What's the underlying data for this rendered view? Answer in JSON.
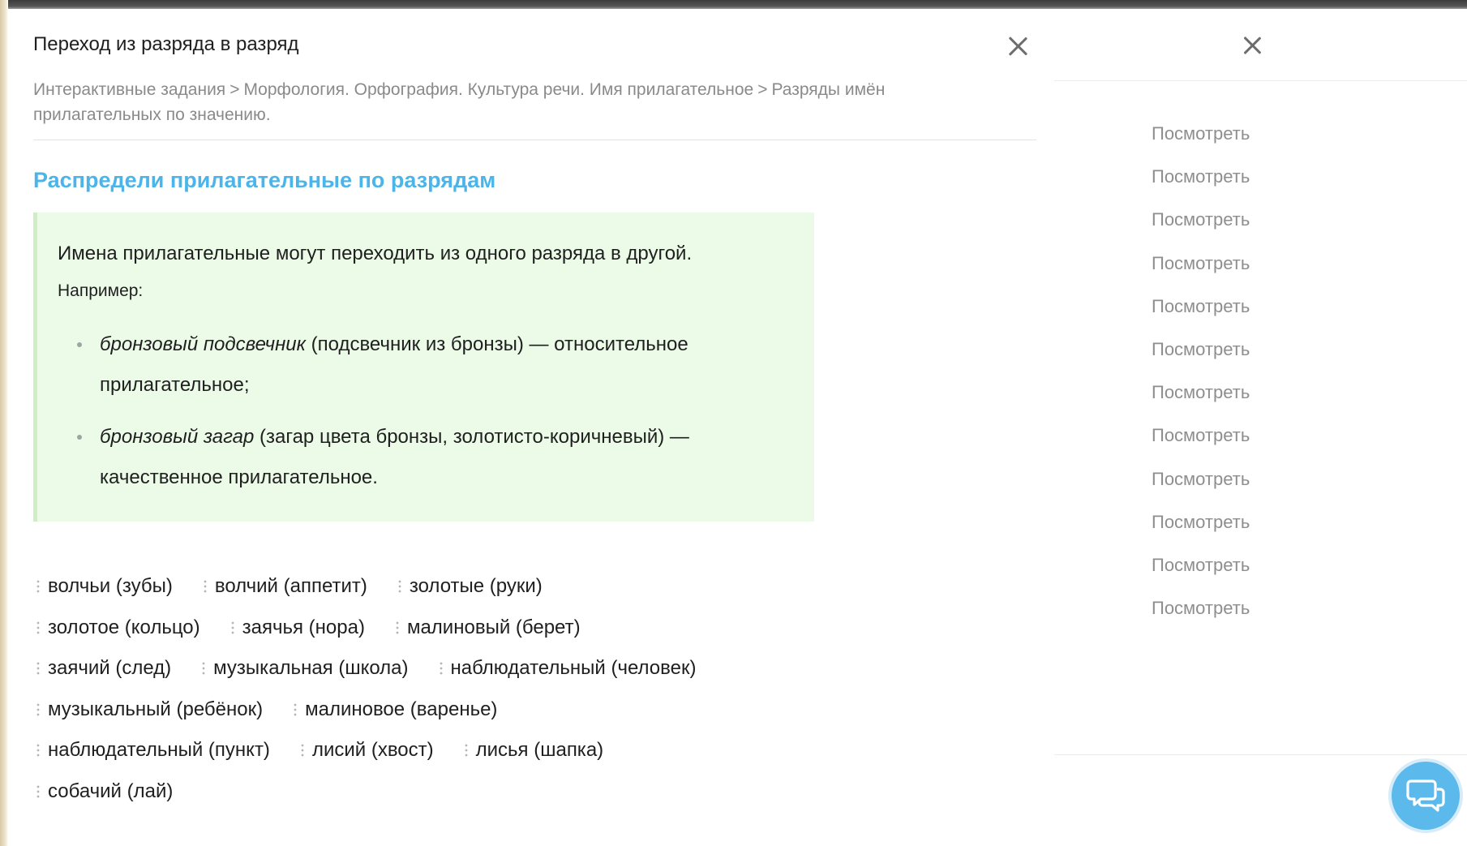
{
  "modal": {
    "title": "Переход из разряда в разряд",
    "breadcrumb": {
      "item1": "Интерактивные задания",
      "separator": ">",
      "item2": "Морфология. Орфография. Культура речи. Имя прилагательное",
      "item3": "Разряды имён прилагательных по значению."
    },
    "task_title": "Распредели прилагательные по разрядам",
    "info": {
      "lead": "Имена прилагательные могут переходить из одного разряда в другой.",
      "example_label": "Например:",
      "examples": [
        {
          "phrase": "бронзовый подсвечник",
          "explanation": " (подсвечник из бронзы) — относительное прилагательное;"
        },
        {
          "phrase": "бронзовый загар",
          "explanation": " (загар цвета бронзы, золотисто-коричневый) — качественное прилагательное."
        }
      ]
    },
    "word_rows": [
      [
        "волчьи (зубы)",
        "волчий (аппетит)",
        "золотые (руки)"
      ],
      [
        "золотое (кольцо)",
        "заячья (нора)",
        "малиновый (берет)"
      ],
      [
        "заячий (след)",
        "музыкальная (школа)",
        "наблюдательный (человек)"
      ],
      [
        "музыкальный (ребёнок)",
        "малиновое (варенье)"
      ],
      [
        "наблюдательный (пункт)",
        "лисий (хвост)",
        "лисья (шапка)"
      ],
      [
        "собачий (лай)"
      ]
    ]
  },
  "side_panel": {
    "view_links": [
      "Посмотреть",
      "Посмотреть",
      "Посмотреть",
      "Посмотреть",
      "Посмотреть",
      "Посмотреть",
      "Посмотреть",
      "Посмотреть",
      "Посмотреть",
      "Посмотреть",
      "Посмотреть",
      "Посмотреть"
    ]
  },
  "colors": {
    "accent": "#4bb5ea",
    "info_bg": "#ecfbe8",
    "chat_button": "#5bb9ec"
  },
  "icons": {
    "modal_close": "close-icon",
    "panel_close": "close-icon",
    "chat": "chat-bubbles-icon",
    "drag": "drag-handle-icon"
  }
}
